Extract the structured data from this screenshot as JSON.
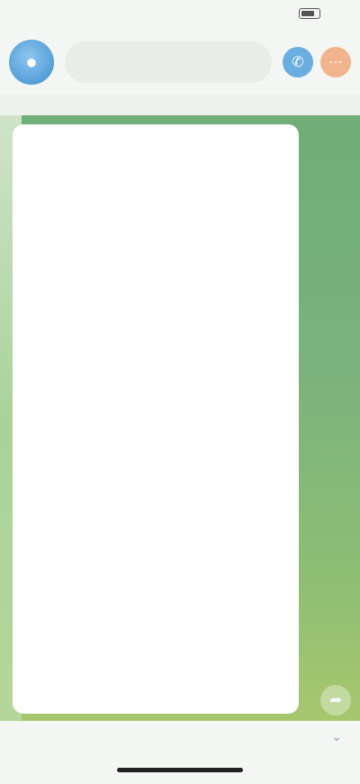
{
  "status_bar": {
    "time": "",
    "right_text": ""
  },
  "header": {
    "avatar_icon": "channel-avatar-icon",
    "title": "",
    "right_buttons": [
      "call-icon",
      "more-icon"
    ]
  },
  "pinned": {
    "title": "",
    "text": ""
  },
  "message": {
    "headline": "",
    "paragraphs": [
      "",
      "",
      "",
      "",
      "",
      ""
    ],
    "meta": ""
  },
  "bottom": {
    "join_label": ""
  },
  "colors": {
    "chat_bg_top": "#6fae78",
    "chat_bg_bottom": "#a7c76e",
    "accent": "#3b8fd0"
  }
}
